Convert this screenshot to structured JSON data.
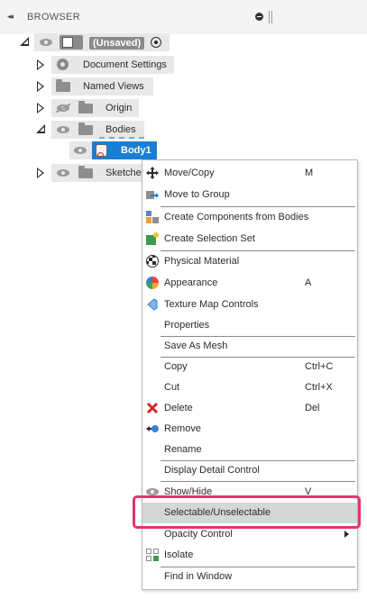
{
  "panel": {
    "collapse_glyph": "◂◂",
    "title": "BROWSER"
  },
  "tree": {
    "root_label": "(Unsaved)",
    "items": [
      {
        "label": "Document Settings"
      },
      {
        "label": "Named Views"
      },
      {
        "label": "Origin"
      },
      {
        "label": "Bodies"
      },
      {
        "label": "Body1"
      },
      {
        "label": "Sketche"
      }
    ]
  },
  "context_menu": {
    "items": [
      {
        "label": "Move/Copy",
        "shortcut": "M",
        "icon": "move-icon"
      },
      {
        "label": "Move to Group",
        "shortcut": "",
        "icon": "move-group-icon"
      },
      {
        "label": "Create Components from Bodies",
        "shortcut": "",
        "icon": "components-icon"
      },
      {
        "label": "Create Selection Set",
        "shortcut": "",
        "icon": "selection-set-icon"
      },
      {
        "label": "Physical Material",
        "shortcut": "",
        "icon": "material-icon"
      },
      {
        "label": "Appearance",
        "shortcut": "A",
        "icon": "appearance-icon"
      },
      {
        "label": "Texture Map Controls",
        "shortcut": "",
        "icon": "texture-icon"
      },
      {
        "label": "Properties",
        "shortcut": ""
      },
      {
        "label": "Save As Mesh",
        "shortcut": ""
      },
      {
        "label": "Copy",
        "shortcut": "Ctrl+C"
      },
      {
        "label": "Cut",
        "shortcut": "Ctrl+X"
      },
      {
        "label": "Delete",
        "shortcut": "Del",
        "icon": "delete-icon"
      },
      {
        "label": "Remove",
        "shortcut": "",
        "icon": "remove-icon"
      },
      {
        "label": "Rename",
        "shortcut": ""
      },
      {
        "label": "Display Detail Control",
        "shortcut": ""
      },
      {
        "label": "Show/Hide",
        "shortcut": "V",
        "icon": "eye-icon"
      },
      {
        "label": "Selectable/Unselectable",
        "shortcut": ""
      },
      {
        "label": "Opacity Control",
        "shortcut": ""
      },
      {
        "label": "Isolate",
        "shortcut": "",
        "icon": "isolate-icon"
      },
      {
        "label": "Find in Window",
        "shortcut": ""
      }
    ]
  },
  "colors": {
    "selection_blue": "#1a7fd4",
    "highlight_pink": "#e8336b",
    "delete_red": "#d9232d"
  }
}
